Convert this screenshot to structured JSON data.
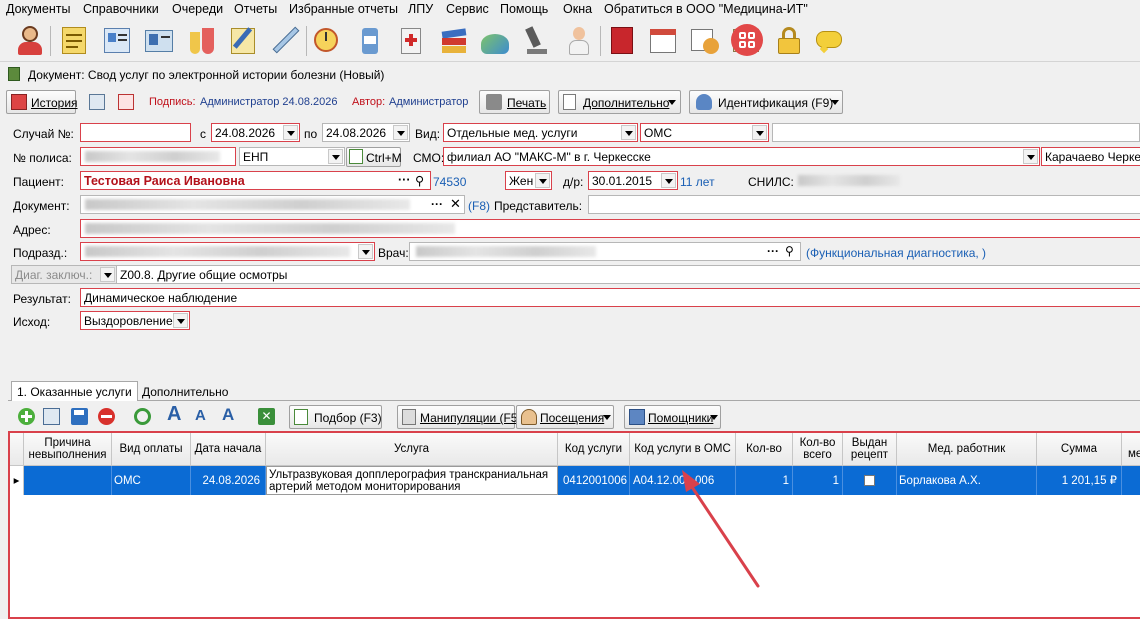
{
  "menu": [
    "Документы",
    "Справочники",
    "Очереди",
    "Отчеты",
    "Избранные отчеты",
    "ЛПУ",
    "Сервис",
    "Помощь",
    "Окна",
    "Обратиться в ООО \"Медицина-ИТ\""
  ],
  "toolbar_icons": [
    "doctor-icon",
    "notepad-icon",
    "patient-card-icon",
    "badge-icon",
    "lab-flasks-icon",
    "pen-notepad-icon",
    "syringe-icon",
    "clock-schedule-icon",
    "pills-bottle-icon",
    "medical-kit-icon",
    "books-stack-icon",
    "mortar-icon",
    "microscope-icon",
    "nurse-icon",
    "red-book-icon",
    "calendar-icon",
    "calendar-clock-icon",
    "news-icon",
    "four-squares-icon",
    "lock-icon",
    "chat-bubble-icon"
  ],
  "document_title": "Документ: Свод услуг по электронной истории болезни (Новый)",
  "actionbar": {
    "history": "История",
    "signature_label": "Подпись:",
    "signature_value": "Администратор 24.08.2026",
    "author_label": "Автор:",
    "author_value": "Администратор",
    "print": "Печать",
    "additional": "Дополнительно",
    "identification": "Идентификация (F9)"
  },
  "form": {
    "case_label": "Случай №:",
    "case_value": "",
    "from_label": "с",
    "date_from": "24.08.2026",
    "to_label": "по",
    "date_to": "24.08.2026",
    "kind_label": "Вид:",
    "kind_value": "Отдельные мед. услуги",
    "payment_value": "ОМС",
    "policy_label": "№ полиса:",
    "policy_type": "ЕНП",
    "ctrl_m": "Ctrl+M",
    "smo_label": "СМО:",
    "smo_value": "филиал АО \"МАКС-М\" в г. Черкесске",
    "region_value": "Карачаево Черке",
    "patient_label": "Пациент:",
    "patient_value": "Тестовая Раиса Ивановна",
    "patient_id": "74530",
    "sex_value": "Жен",
    "dob_label": "д/р:",
    "dob_value": "30.01.2015",
    "age_value": "11 лет",
    "snils_label": "СНИЛС:",
    "document_label": "Документ:",
    "f8_hint": "(F8)",
    "representative_label": "Представитель:",
    "address_label": "Адрес:",
    "department_label": "Подразд.:",
    "doctor_label": "Врач:",
    "doctor_spec": "(Функциональная диагностика, )",
    "diag_label": "Диаг. заключ.:",
    "diag_value": "Z00.8. Другие общие осмотры",
    "result_label": "Результат:",
    "result_value": "Динамическое наблюдение",
    "outcome_label": "Исход:",
    "outcome_value": "Выздоровление"
  },
  "tabs": [
    "1. Оказанные услуги",
    "Дополнительно"
  ],
  "grid_toolbar": {
    "selection": "Подбор (F3)",
    "manipulations": "Манипуляции (F5)",
    "visits": "Посещения",
    "helpers": "Помощники"
  },
  "grid": {
    "columns": [
      "Причина невыполнения",
      "Вид оплаты",
      "Дата начала",
      "Услуга",
      "Код услуги",
      "Код услуги в ОМС",
      "Кол-во",
      "Кол-во всего",
      "Выдан рецепт",
      "Мед. работник",
      "Сумма",
      "ме"
    ],
    "rows": [
      {
        "reason": "",
        "payment": "ОМС",
        "start_date": "24.08.2026",
        "service": "Ультразвуковая допплерография транскраниальная артерий методом мониторирования",
        "code": "0412001006",
        "oms_code": "A04.12.001.006",
        "qty": "1",
        "qty_total": "1",
        "recipe_issued": false,
        "worker": "Борлакова А.Х.",
        "sum": "1 201,15 ₽"
      }
    ]
  },
  "colors": {
    "required_border": "#d9414b",
    "selection": "#0b6bd4",
    "link_blue": "#1a5fb4",
    "annotation_arrow": "#d9414b"
  }
}
